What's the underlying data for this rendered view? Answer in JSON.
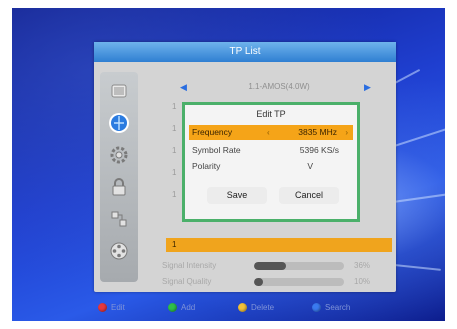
{
  "window": {
    "title": "TP List"
  },
  "satellite": {
    "name": "1.1-AMOS(4.0W)"
  },
  "sidebar": {
    "items": [
      {
        "icon": "satellite-icon"
      },
      {
        "icon": "globe-icon"
      },
      {
        "icon": "gear-icon"
      },
      {
        "icon": "lock-icon"
      },
      {
        "icon": "network-icon"
      },
      {
        "icon": "film-reel-icon"
      }
    ]
  },
  "tp_list": {
    "rows": [
      "1",
      "1",
      "1",
      "1",
      "1",
      "1"
    ]
  },
  "signal": {
    "intensity_label": "Signal Intensity",
    "intensity_value": "36%",
    "intensity_level": 0.36,
    "quality_label": "Signal Quality",
    "quality_value": "10%",
    "quality_level": 0.1
  },
  "dialog": {
    "title": "Edit TP",
    "fields": [
      {
        "label": "Frequency",
        "value": "3835 MHz"
      },
      {
        "label": "Symbol Rate",
        "value": "5396 KS/s"
      },
      {
        "label": "Polarity",
        "value": "V"
      }
    ],
    "save_label": "Save",
    "cancel_label": "Cancel"
  },
  "footer": {
    "items": [
      {
        "label": "Edit",
        "color": "#e8383d"
      },
      {
        "label": "Add",
        "color": "#2fbf4a"
      },
      {
        "label": "Delete",
        "color": "#f2c23a"
      },
      {
        "label": "Search",
        "color": "#3a7af0"
      }
    ]
  },
  "colors": {
    "highlight": "#f5a418",
    "dialog_border": "#4bb06a",
    "title_bar": "#2f7fd2"
  }
}
